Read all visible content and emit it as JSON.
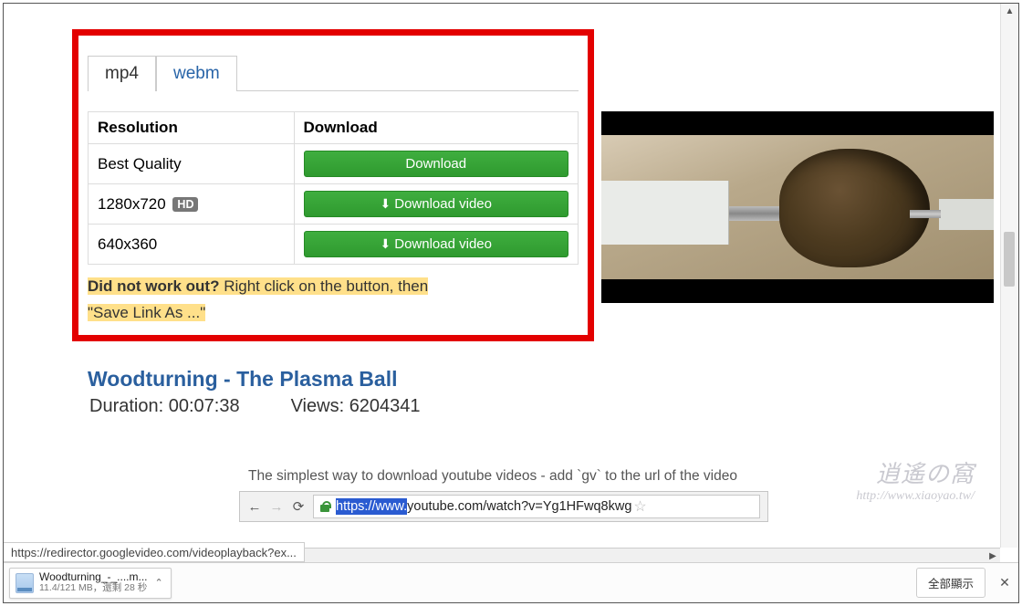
{
  "tabs": {
    "mp4": "mp4",
    "webm": "webm"
  },
  "table": {
    "col_resolution": "Resolution",
    "col_download": "Download",
    "rows": [
      {
        "res": "Best Quality",
        "hd": "",
        "btn": "Download",
        "icon": false
      },
      {
        "res": "1280x720",
        "hd": "HD",
        "btn": "Download video",
        "icon": true
      },
      {
        "res": "640x360",
        "hd": "",
        "btn": "Download video",
        "icon": true
      }
    ]
  },
  "hint": {
    "lead": "Did not work out?",
    "mid": " Right click on the button, then ",
    "tail": "\"Save Link As ...\""
  },
  "video": {
    "title": "Woodturning - The Plasma Ball",
    "duration_label": "Duration: ",
    "duration": "00:07:38",
    "views_label": "Views: ",
    "views": "6204341"
  },
  "tagline": "The simplest way to download youtube videos - add `gv` to the url of the video",
  "urlbar": {
    "selected": "https://www.",
    "rest": "youtube.com/watch?v=Yg1HFwq8kwg"
  },
  "status_bar": "https://redirector.googlevideo.com/videoplayback?ex...",
  "shelf": {
    "file": "Woodturning_-_....m...",
    "sub": "11.4/121 MB，還剩 28 秒",
    "show_all": "全部顯示"
  },
  "watermark": {
    "line1": "逍遙の窩",
    "line2": "http://www.xiaoyao.tw/"
  }
}
